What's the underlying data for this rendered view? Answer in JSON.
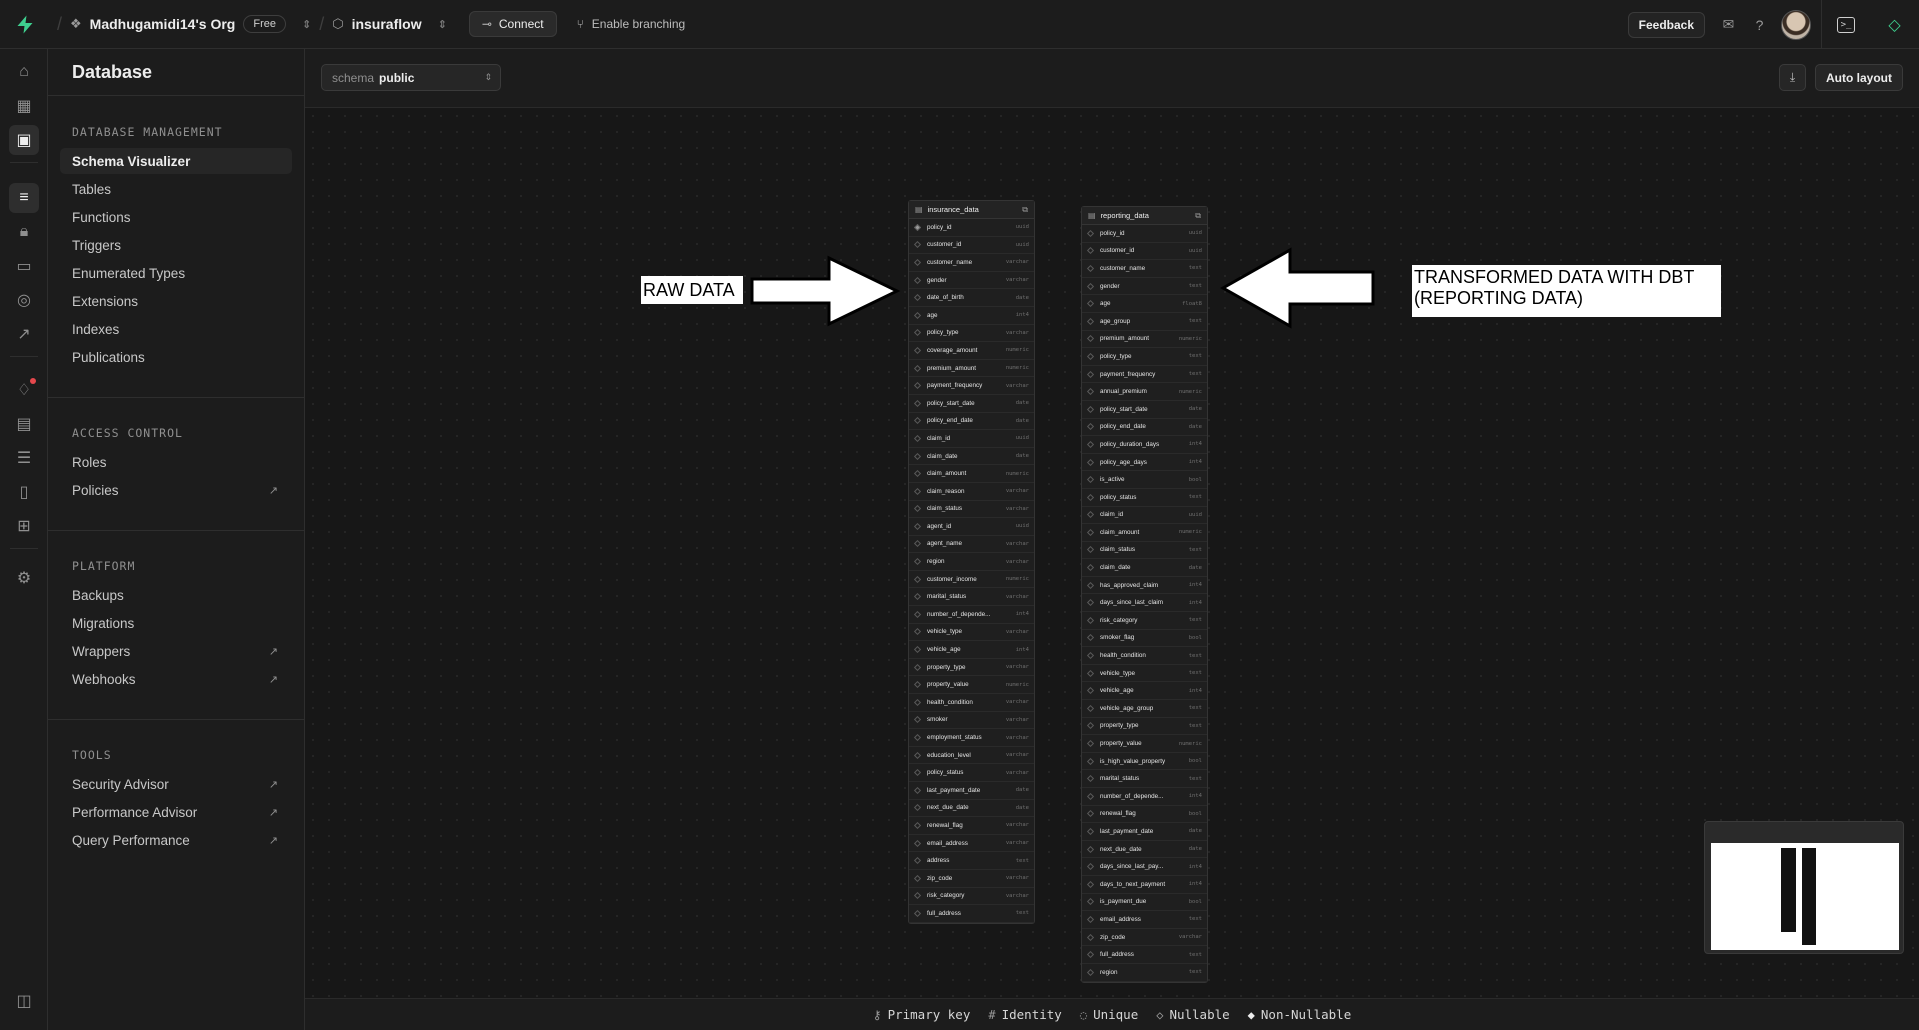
{
  "topbar": {
    "org": "Madhugamidi14's Org",
    "plan_badge": "Free",
    "project": "insuraflow",
    "connect_label": "Connect",
    "branching_label": "Enable branching",
    "feedback_label": "Feedback"
  },
  "sidebar": {
    "title": "Database",
    "sections": [
      {
        "heading": "DATABASE MANAGEMENT",
        "items": [
          {
            "label": "Schema Visualizer",
            "active": true,
            "external": false
          },
          {
            "label": "Tables",
            "active": false,
            "external": false
          },
          {
            "label": "Functions",
            "active": false,
            "external": false
          },
          {
            "label": "Triggers",
            "active": false,
            "external": false
          },
          {
            "label": "Enumerated Types",
            "active": false,
            "external": false
          },
          {
            "label": "Extensions",
            "active": false,
            "external": false
          },
          {
            "label": "Indexes",
            "active": false,
            "external": false
          },
          {
            "label": "Publications",
            "active": false,
            "external": false
          }
        ]
      },
      {
        "heading": "ACCESS CONTROL",
        "items": [
          {
            "label": "Roles",
            "active": false,
            "external": false
          },
          {
            "label": "Policies",
            "active": false,
            "external": true
          }
        ]
      },
      {
        "heading": "PLATFORM",
        "items": [
          {
            "label": "Backups",
            "active": false,
            "external": false
          },
          {
            "label": "Migrations",
            "active": false,
            "external": false
          },
          {
            "label": "Wrappers",
            "active": false,
            "external": true
          },
          {
            "label": "Webhooks",
            "active": false,
            "external": true
          }
        ]
      },
      {
        "heading": "TOOLS",
        "items": [
          {
            "label": "Security Advisor",
            "active": false,
            "external": true
          },
          {
            "label": "Performance Advisor",
            "active": false,
            "external": true
          },
          {
            "label": "Query Performance",
            "active": false,
            "external": true
          }
        ]
      }
    ]
  },
  "toolbar": {
    "schema_label": "schema",
    "schema_value": "public",
    "auto_layout_label": "Auto layout"
  },
  "tables": [
    {
      "name": "insurance_data",
      "columns": [
        {
          "name": "policy_id",
          "type": "uuid",
          "primary": true
        },
        {
          "name": "customer_id",
          "type": "uuid"
        },
        {
          "name": "customer_name",
          "type": "varchar"
        },
        {
          "name": "gender",
          "type": "varchar"
        },
        {
          "name": "date_of_birth",
          "type": "date"
        },
        {
          "name": "age",
          "type": "int4"
        },
        {
          "name": "policy_type",
          "type": "varchar"
        },
        {
          "name": "coverage_amount",
          "type": "numeric"
        },
        {
          "name": "premium_amount",
          "type": "numeric"
        },
        {
          "name": "payment_frequency",
          "type": "varchar"
        },
        {
          "name": "policy_start_date",
          "type": "date"
        },
        {
          "name": "policy_end_date",
          "type": "date"
        },
        {
          "name": "claim_id",
          "type": "uuid"
        },
        {
          "name": "claim_date",
          "type": "date"
        },
        {
          "name": "claim_amount",
          "type": "numeric"
        },
        {
          "name": "claim_reason",
          "type": "varchar"
        },
        {
          "name": "claim_status",
          "type": "varchar"
        },
        {
          "name": "agent_id",
          "type": "uuid"
        },
        {
          "name": "agent_name",
          "type": "varchar"
        },
        {
          "name": "region",
          "type": "varchar"
        },
        {
          "name": "customer_income",
          "type": "numeric"
        },
        {
          "name": "marital_status",
          "type": "varchar"
        },
        {
          "name": "number_of_depende...",
          "type": "int4"
        },
        {
          "name": "vehicle_type",
          "type": "varchar"
        },
        {
          "name": "vehicle_age",
          "type": "int4"
        },
        {
          "name": "property_type",
          "type": "varchar"
        },
        {
          "name": "property_value",
          "type": "numeric"
        },
        {
          "name": "health_condition",
          "type": "varchar"
        },
        {
          "name": "smoker",
          "type": "varchar"
        },
        {
          "name": "employment_status",
          "type": "varchar"
        },
        {
          "name": "education_level",
          "type": "varchar"
        },
        {
          "name": "policy_status",
          "type": "varchar"
        },
        {
          "name": "last_payment_date",
          "type": "date"
        },
        {
          "name": "next_due_date",
          "type": "date"
        },
        {
          "name": "renewal_flag",
          "type": "varchar"
        },
        {
          "name": "email_address",
          "type": "varchar"
        },
        {
          "name": "address",
          "type": "text"
        },
        {
          "name": "zip_code",
          "type": "varchar"
        },
        {
          "name": "risk_category",
          "type": "varchar"
        },
        {
          "name": "full_address",
          "type": "text"
        }
      ]
    },
    {
      "name": "reporting_data",
      "columns": [
        {
          "name": "policy_id",
          "type": "uuid"
        },
        {
          "name": "customer_id",
          "type": "uuid"
        },
        {
          "name": "customer_name",
          "type": "text"
        },
        {
          "name": "gender",
          "type": "text"
        },
        {
          "name": "age",
          "type": "float8"
        },
        {
          "name": "age_group",
          "type": "text"
        },
        {
          "name": "premium_amount",
          "type": "numeric"
        },
        {
          "name": "policy_type",
          "type": "text"
        },
        {
          "name": "payment_frequency",
          "type": "text"
        },
        {
          "name": "annual_premium",
          "type": "numeric"
        },
        {
          "name": "policy_start_date",
          "type": "date"
        },
        {
          "name": "policy_end_date",
          "type": "date"
        },
        {
          "name": "policy_duration_days",
          "type": "int4"
        },
        {
          "name": "policy_age_days",
          "type": "int4"
        },
        {
          "name": "is_active",
          "type": "bool"
        },
        {
          "name": "policy_status",
          "type": "text"
        },
        {
          "name": "claim_id",
          "type": "uuid"
        },
        {
          "name": "claim_amount",
          "type": "numeric"
        },
        {
          "name": "claim_status",
          "type": "text"
        },
        {
          "name": "claim_date",
          "type": "date"
        },
        {
          "name": "has_approved_claim",
          "type": "int4"
        },
        {
          "name": "days_since_last_claim",
          "type": "int4"
        },
        {
          "name": "risk_category",
          "type": "text"
        },
        {
          "name": "smoker_flag",
          "type": "bool"
        },
        {
          "name": "health_condition",
          "type": "text"
        },
        {
          "name": "vehicle_type",
          "type": "text"
        },
        {
          "name": "vehicle_age",
          "type": "int4"
        },
        {
          "name": "vehicle_age_group",
          "type": "text"
        },
        {
          "name": "property_type",
          "type": "text"
        },
        {
          "name": "property_value",
          "type": "numeric"
        },
        {
          "name": "is_high_value_property",
          "type": "bool"
        },
        {
          "name": "marital_status",
          "type": "text"
        },
        {
          "name": "number_of_depende...",
          "type": "int4"
        },
        {
          "name": "renewal_flag",
          "type": "bool"
        },
        {
          "name": "last_payment_date",
          "type": "date"
        },
        {
          "name": "next_due_date",
          "type": "date"
        },
        {
          "name": "days_since_last_pay...",
          "type": "int4"
        },
        {
          "name": "days_to_next_payment",
          "type": "int4"
        },
        {
          "name": "is_payment_due",
          "type": "bool"
        },
        {
          "name": "email_address",
          "type": "text"
        },
        {
          "name": "zip_code",
          "type": "varchar"
        },
        {
          "name": "full_address",
          "type": "text"
        },
        {
          "name": "region",
          "type": "text"
        }
      ]
    }
  ],
  "annotations": {
    "raw": "RAW DATA",
    "transformed": "TRANSFORMED DATA WITH DBT (REPORTING DATA)"
  },
  "legend": [
    "Primary key",
    "Identity",
    "Unique",
    "Nullable",
    "Non-Nullable"
  ],
  "colors": {
    "accent": "#3ecf8e",
    "background": "#1c1c1c",
    "canvas": "#171717"
  }
}
